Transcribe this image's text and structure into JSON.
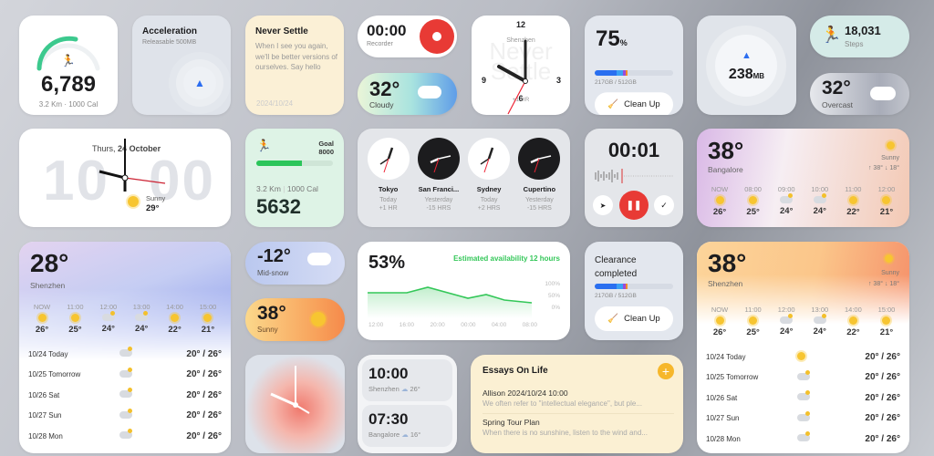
{
  "steps_ring": {
    "value": "6,789",
    "sub": "3.2 Km · 1000 Cal",
    "icon": "running-icon",
    "progress": 0.6
  },
  "acceleration": {
    "title": "Acceleration",
    "sub": "Releasable 500MB",
    "icon": "rocket-icon"
  },
  "note": {
    "title": "Never Settle",
    "body": "When I see you again, we'll be better versions of ourselves. Say hello",
    "date": "2024/10/24"
  },
  "recorder_idle": {
    "time": "00:00",
    "label": "Recorder"
  },
  "weather_cloudy": {
    "temp": "32°",
    "cond": "Cloudy"
  },
  "analog_clock": {
    "city": "Shenzhen",
    "offset": "+1 HR",
    "n12": "12",
    "n3": "3",
    "n6": "6",
    "n9": "9",
    "watermark": "Never Settle"
  },
  "storage": {
    "percent": "75",
    "unit": "%",
    "usage": "217GB / 512GB",
    "button": "Clean Up",
    "fill": 0.42
  },
  "memory": {
    "value": "238",
    "unit": "MB"
  },
  "steps_pill": {
    "value": "18,031",
    "label": "Steps"
  },
  "weather_overcast": {
    "temp": "32°",
    "cond": "Overcast"
  },
  "big_clock": {
    "date_prefix": "Thurs,",
    "day": "24",
    "month": "October",
    "hour": "10",
    "minute": "00",
    "cond": "Sunny",
    "temp": "29°"
  },
  "goal": {
    "label": "Goal",
    "target": "8000",
    "km": "3.2 Km",
    "cal": "1000 Cal",
    "value": "5632",
    "progress": 0.7
  },
  "world_clocks": [
    {
      "city": "Tokyo",
      "day": "Today",
      "offset": "+1 HR",
      "dark": false
    },
    {
      "city": "San Franci...",
      "day": "Yesterday",
      "offset": "-15 HRS",
      "dark": true
    },
    {
      "city": "Sydney",
      "day": "Today",
      "offset": "+2 HRS",
      "dark": false
    },
    {
      "city": "Cupertino",
      "day": "Yesterday",
      "offset": "-15 HRS",
      "dark": true
    }
  ],
  "recorder_active": {
    "time": "00:01"
  },
  "weather_bangalore": {
    "temp": "38°",
    "city": "Bangalore",
    "cond": "Sunny",
    "hi": "↑ 38°",
    "lo": "↓ 18°",
    "hourly": [
      {
        "time": "NOW",
        "icon": "sun",
        "temp": "26°"
      },
      {
        "time": "08:00",
        "icon": "sun",
        "temp": "25°"
      },
      {
        "time": "09:00",
        "icon": "cloud",
        "temp": "24°"
      },
      {
        "time": "10:00",
        "icon": "cloud",
        "temp": "24°"
      },
      {
        "time": "11:00",
        "icon": "sun",
        "temp": "22°"
      },
      {
        "time": "12:00",
        "icon": "sun",
        "temp": "21°"
      }
    ]
  },
  "weather_shenzhen_28": {
    "temp": "28°",
    "city": "Shenzhen",
    "hourly": [
      {
        "time": "NOW",
        "icon": "sun",
        "temp": "26°"
      },
      {
        "time": "11:00",
        "icon": "sun",
        "temp": "25°"
      },
      {
        "time": "12:00",
        "icon": "cloud",
        "temp": "24°"
      },
      {
        "time": "13:00",
        "icon": "cloud",
        "temp": "24°"
      },
      {
        "time": "14:00",
        "icon": "sun",
        "temp": "22°"
      },
      {
        "time": "15:00",
        "icon": "sun",
        "temp": "21°"
      }
    ],
    "daily": [
      {
        "date": "10/24 Today",
        "icon": "cloud",
        "range": "20° / 26°"
      },
      {
        "date": "10/25 Tomorrow",
        "icon": "cloud",
        "range": "20° / 26°"
      },
      {
        "date": "10/26 Sat",
        "icon": "cloud",
        "range": "20° / 26°"
      },
      {
        "date": "10/27 Sun",
        "icon": "cloud",
        "range": "20° / 26°"
      },
      {
        "date": "10/28 Mon",
        "icon": "cloud",
        "range": "20° / 26°"
      }
    ]
  },
  "weather_snow": {
    "temp": "-12°",
    "cond": "Mid-snow"
  },
  "weather_sunny": {
    "temp": "38°",
    "cond": "Sunny"
  },
  "battery": {
    "percent": "53%",
    "estimate": "Estimated availability 12 hours",
    "y_labels": [
      "100%",
      "50%",
      "0%"
    ],
    "x_labels": [
      "12:00",
      "16:00",
      "20:00",
      "00:00",
      "04:00",
      "08:00"
    ],
    "accent": "#34c759"
  },
  "clearance": {
    "title": "Clearance completed",
    "usage": "217GB / 512GB",
    "button": "Clean Up",
    "fill": 0.42
  },
  "time_list": [
    {
      "time": "10:00",
      "city": "Shenzhen",
      "temp": "26°"
    },
    {
      "time": "07:30",
      "city": "Bangalore",
      "temp": "16°"
    }
  ],
  "essays": {
    "title": "Essays On Life",
    "items": [
      {
        "title": "Allison 2024/10/24 10:00",
        "body": "We often refer to \"intellectual elegance\", but ple..."
      },
      {
        "title": "Spring Tour Plan",
        "body": "When there is no sunshine, listen to the wind and..."
      }
    ]
  },
  "weather_shenzhen_38": {
    "temp": "38°",
    "city": "Shenzhen",
    "cond": "Sunny",
    "hi": "↑ 38°",
    "lo": "↓ 18°",
    "hourly": [
      {
        "time": "NOW",
        "icon": "sun",
        "temp": "26°"
      },
      {
        "time": "11:00",
        "icon": "sun",
        "temp": "25°"
      },
      {
        "time": "12:00",
        "icon": "cloud",
        "temp": "24°"
      },
      {
        "time": "13:00",
        "icon": "cloud",
        "temp": "24°"
      },
      {
        "time": "14:00",
        "icon": "sun",
        "temp": "22°"
      },
      {
        "time": "15:00",
        "icon": "sun",
        "temp": "21°"
      }
    ],
    "daily": [
      {
        "date": "10/24 Today",
        "icon": "sun",
        "range": "20° / 26°"
      },
      {
        "date": "10/25 Tomorrow",
        "icon": "cloud",
        "range": "20° / 26°"
      },
      {
        "date": "10/26 Sat",
        "icon": "cloud",
        "range": "20° / 26°"
      },
      {
        "date": "10/27 Sun",
        "icon": "cloud",
        "range": "20° / 26°"
      },
      {
        "date": "10/28 Mon",
        "icon": "cloud",
        "range": "20° / 26°"
      }
    ]
  }
}
